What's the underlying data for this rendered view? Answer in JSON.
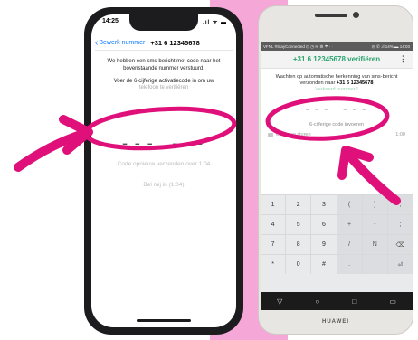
{
  "iphone": {
    "status": {
      "time": "14:25",
      "icons": ".ıl ᯤ ▬"
    },
    "nav": {
      "back_label": "Bewerk nummer",
      "title": "+31 6 12345678"
    },
    "message1": "We hebben een sms-bericht met code naar het bovenstaande nummer verstuurd.",
    "message2": "Voer de 6-cijferige activatiecode in om uw",
    "message2_faded": "telefoon te verifiëren",
    "code": "--- ---",
    "resend": "Code opnieuw verzenden over 1:04",
    "call": "Bel mij in (1:04)"
  },
  "android": {
    "status": {
      "left": "VFNL #StayConnected ⊡ ◷ ✉ ⚙ ☂ · ·",
      "right": "⊟ ✆ .ıl 14% ▬ 14:03"
    },
    "title": "+31 6 12345678  verifiëren",
    "menu_icon": "⋮",
    "message_prefix": "Wachten op automatische herkenning van sms-bericht verzonden naar ",
    "message_number": "+31 6 12345678",
    "message_faded": "Verkeerd nummer?",
    "code": "--- ---",
    "hint": "6-cijferige code invoeren",
    "resend_label": "Opnieuw sturen",
    "resend_timer": "1:00",
    "keyboard": [
      [
        "1",
        "2",
        "3",
        "(",
        ")",
        ","
      ],
      [
        "4",
        "5",
        "6",
        "+",
        "-",
        ";"
      ],
      [
        "7",
        "8",
        "9",
        "/",
        "N",
        "⌫"
      ],
      [
        "*",
        "0",
        "#",
        ".",
        "",
        "⏎"
      ]
    ],
    "nav": {
      "back": "▽",
      "home": "○",
      "recent": "□",
      "extra": "▭"
    },
    "brand": "HUAWEI"
  },
  "colors": {
    "pink_marker": "#e0107a",
    "whatsapp_green": "#2aa36e",
    "ios_blue": "#0a7aff"
  }
}
